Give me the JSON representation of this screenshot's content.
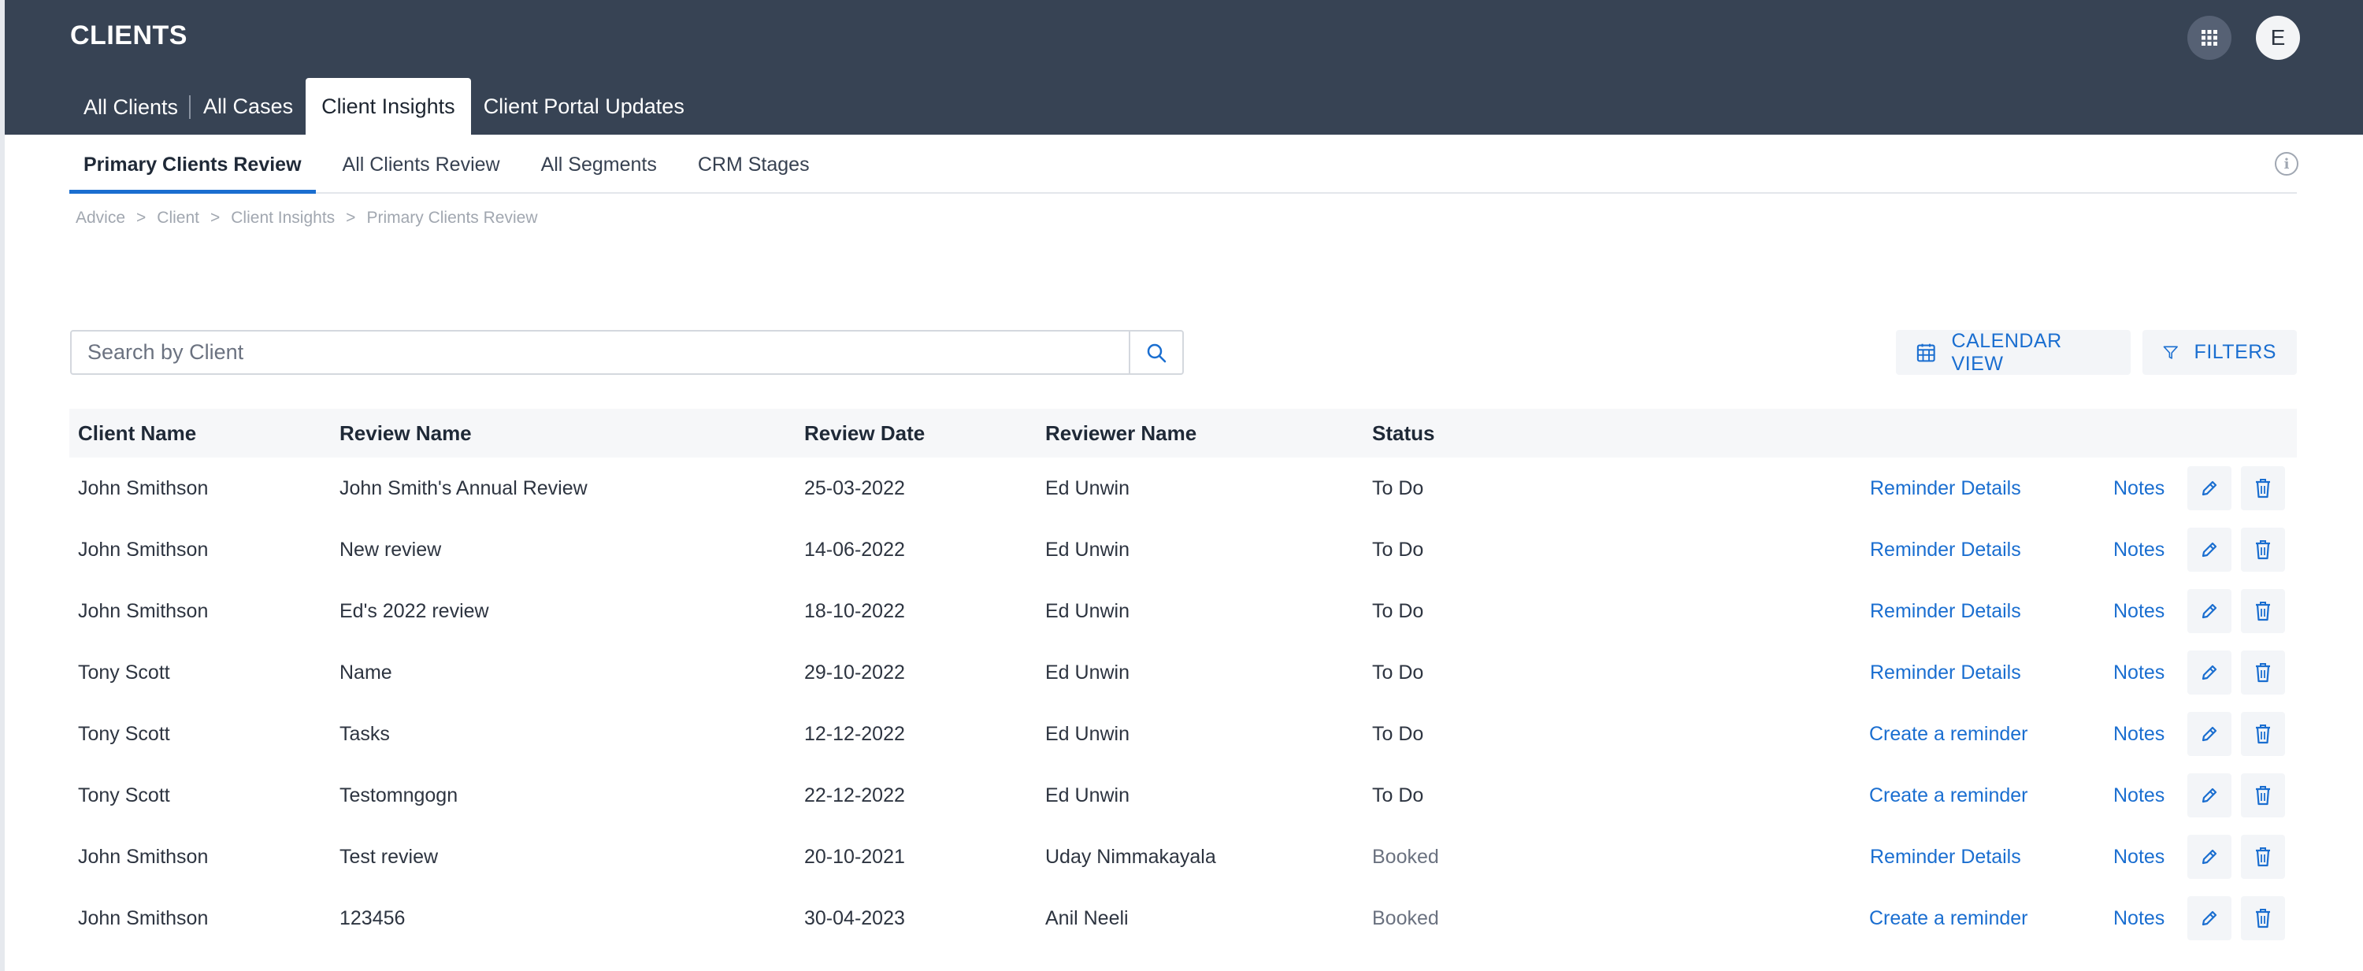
{
  "app": {
    "title": "CLIENTS",
    "avatar_initial": "E"
  },
  "top_tabs": [
    {
      "label": "All Clients",
      "active": false
    },
    {
      "label": "All Cases",
      "active": false
    },
    {
      "label": "Client Insights",
      "active": true
    },
    {
      "label": "Client Portal Updates",
      "active": false
    }
  ],
  "sub_tabs": [
    {
      "label": "Primary Clients Review",
      "active": true
    },
    {
      "label": "All Clients Review",
      "active": false
    },
    {
      "label": "All Segments",
      "active": false
    },
    {
      "label": "CRM Stages",
      "active": false
    }
  ],
  "breadcrumb": [
    "Advice",
    ">",
    "Client",
    ">",
    "Client Insights",
    ">",
    "Primary Clients Review"
  ],
  "search": {
    "placeholder": "Search by Client",
    "value": ""
  },
  "actions": {
    "calendar_label": "CALENDAR VIEW",
    "filters_label": "FILTERS"
  },
  "table": {
    "columns": [
      "Client Name",
      "Review Name",
      "Review Date",
      "Reviewer Name",
      "Status"
    ],
    "rows": [
      {
        "client": "John Smithson",
        "review": "John Smith's Annual Review",
        "date": "25-03-2022",
        "reviewer": "Ed Unwin",
        "status": "To Do",
        "reminder": "Reminder Details",
        "notes": "Notes"
      },
      {
        "client": "John Smithson",
        "review": "New review",
        "date": "14-06-2022",
        "reviewer": "Ed Unwin",
        "status": "To Do",
        "reminder": "Reminder Details",
        "notes": "Notes"
      },
      {
        "client": "John Smithson",
        "review": "Ed's 2022 review",
        "date": "18-10-2022",
        "reviewer": "Ed Unwin",
        "status": "To Do",
        "reminder": "Reminder Details",
        "notes": "Notes"
      },
      {
        "client": "Tony Scott",
        "review": "Name",
        "date": "29-10-2022",
        "reviewer": "Ed Unwin",
        "status": "To Do",
        "reminder": "Reminder Details",
        "notes": "Notes"
      },
      {
        "client": "Tony Scott",
        "review": "Tasks",
        "date": "12-12-2022",
        "reviewer": "Ed Unwin",
        "status": "To Do",
        "reminder": "Create a reminder",
        "notes": "Notes"
      },
      {
        "client": "Tony Scott",
        "review": "Testomngogn",
        "date": "22-12-2022",
        "reviewer": "Ed Unwin",
        "status": "To Do",
        "reminder": "Create a reminder",
        "notes": "Notes"
      },
      {
        "client": "John Smithson",
        "review": "Test review",
        "date": "20-10-2021",
        "reviewer": "Uday Nimmakayala",
        "status": "Booked",
        "reminder": "Reminder Details",
        "notes": "Notes"
      },
      {
        "client": "John Smithson",
        "review": "123456",
        "date": "30-04-2023",
        "reviewer": "Anil Neeli",
        "status": "Booked",
        "reminder": "Create a reminder",
        "notes": "Notes"
      }
    ]
  },
  "colors": {
    "header_bg": "#374354",
    "accent": "#1a6ed0"
  },
  "icons": [
    "apps-grid-icon",
    "info-icon",
    "search-icon",
    "calendar-icon",
    "filter-icon",
    "pencil-icon",
    "trash-icon"
  ]
}
